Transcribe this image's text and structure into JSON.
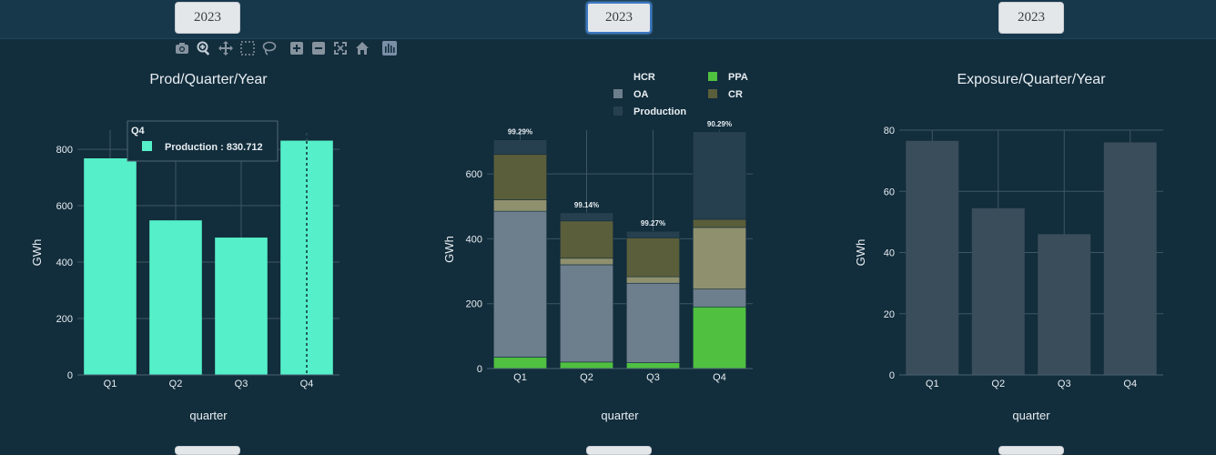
{
  "year_buttons": [
    {
      "label": "2023",
      "active": false
    },
    {
      "label": "2023",
      "active": true
    },
    {
      "label": "2023",
      "active": false
    }
  ],
  "modebar_icons": [
    "camera-icon",
    "zoom-icon",
    "pan-icon",
    "box-select-icon",
    "lasso-icon",
    "zoom-in-icon",
    "zoom-out-icon",
    "autoscale-icon",
    "home-icon",
    "plotly-logo-icon"
  ],
  "colors": {
    "production_left": "#55f0c9",
    "ppa": "#4fc040",
    "oa": "#6d7e8c",
    "hcr": "#8f906e",
    "cr": "#5a5e3a",
    "production_mid": "#27404f",
    "exposure": "#3a4d5a"
  },
  "chart_data": [
    {
      "type": "bar",
      "title": "Prod/Quarter/Year",
      "xlabel": "quarter",
      "ylabel": "GWh",
      "categories": [
        "Q1",
        "Q2",
        "Q3",
        "Q4"
      ],
      "series": [
        {
          "name": "Production",
          "values": [
            768,
            548,
            487,
            830.712
          ]
        }
      ],
      "ylim": [
        0,
        868
      ],
      "yticks": [
        0,
        200,
        400,
        600,
        800
      ],
      "grid": true,
      "tooltip": {
        "title": "Q4",
        "label": "Production : 830.712"
      }
    },
    {
      "type": "bar",
      "stacked": true,
      "title": "",
      "xlabel": "quarter",
      "ylabel": "GWh",
      "categories": [
        "Q1",
        "Q2",
        "Q3",
        "Q4"
      ],
      "series": [
        {
          "name": "PPA",
          "values": [
            35,
            20,
            18,
            190
          ]
        },
        {
          "name": "OA",
          "values": [
            450,
            300,
            245,
            55
          ]
        },
        {
          "name": "HCR",
          "values": [
            35,
            20,
            20,
            190
          ]
        },
        {
          "name": "CR",
          "values": [
            140,
            115,
            120,
            25
          ]
        },
        {
          "name": "Production",
          "values": [
            45,
            25,
            20,
            270
          ]
        }
      ],
      "data_labels": [
        "99.29%",
        "99.14%",
        "99.27%",
        "90.29%"
      ],
      "legend": [
        {
          "name": "HCR",
          "swatch": false
        },
        {
          "name": "PPA",
          "swatch": true
        },
        {
          "name": "OA",
          "swatch": true
        },
        {
          "name": "CR",
          "swatch": true
        },
        {
          "name": "Production",
          "swatch": true
        }
      ],
      "legend_position": "top",
      "ylim": [
        0,
        735
      ],
      "yticks": [
        0,
        200,
        400,
        600
      ],
      "grid": true
    },
    {
      "type": "bar",
      "title": "Exposure/Quarter/Year",
      "xlabel": "quarter",
      "ylabel": "GWh",
      "categories": [
        "Q1",
        "Q2",
        "Q3",
        "Q4"
      ],
      "series": [
        {
          "name": "Exposure",
          "values": [
            76.5,
            54.5,
            46,
            76
          ]
        }
      ],
      "ylim": [
        0,
        80
      ],
      "yticks": [
        0,
        20,
        40,
        60,
        80
      ],
      "grid": true
    }
  ]
}
